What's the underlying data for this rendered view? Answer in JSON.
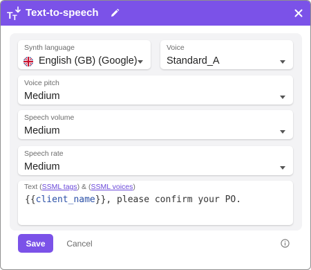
{
  "dialog": {
    "title": "Text-to-speech",
    "title_icon": "text-to-speech-icon",
    "edit_icon": "pencil-icon",
    "close_icon": "close-icon",
    "accent_color": "#7b52e8"
  },
  "fields": {
    "synth_language": {
      "label": "Synth language",
      "value": "English (GB) (Google)",
      "icon": "uk-flag-icon"
    },
    "voice": {
      "label": "Voice",
      "value": "Standard_A"
    },
    "voice_pitch": {
      "label": "Voice pitch",
      "value": "Medium"
    },
    "speech_volume": {
      "label": "Speech volume",
      "value": "Medium"
    },
    "speech_rate": {
      "label": "Speech rate",
      "value": "Medium"
    }
  },
  "text_field": {
    "label_prefix": "Text (",
    "ssml_tags_link": "SSML tags",
    "label_middle": ") & (",
    "ssml_voices_link": "SSML voices",
    "label_suffix": ")",
    "open_braces": "{{",
    "variable": "client_name",
    "close_braces": "}}",
    "rest": ", please confirm your PO."
  },
  "footer": {
    "save_label": "Save",
    "cancel_label": "Cancel",
    "info_icon": "info-icon"
  }
}
